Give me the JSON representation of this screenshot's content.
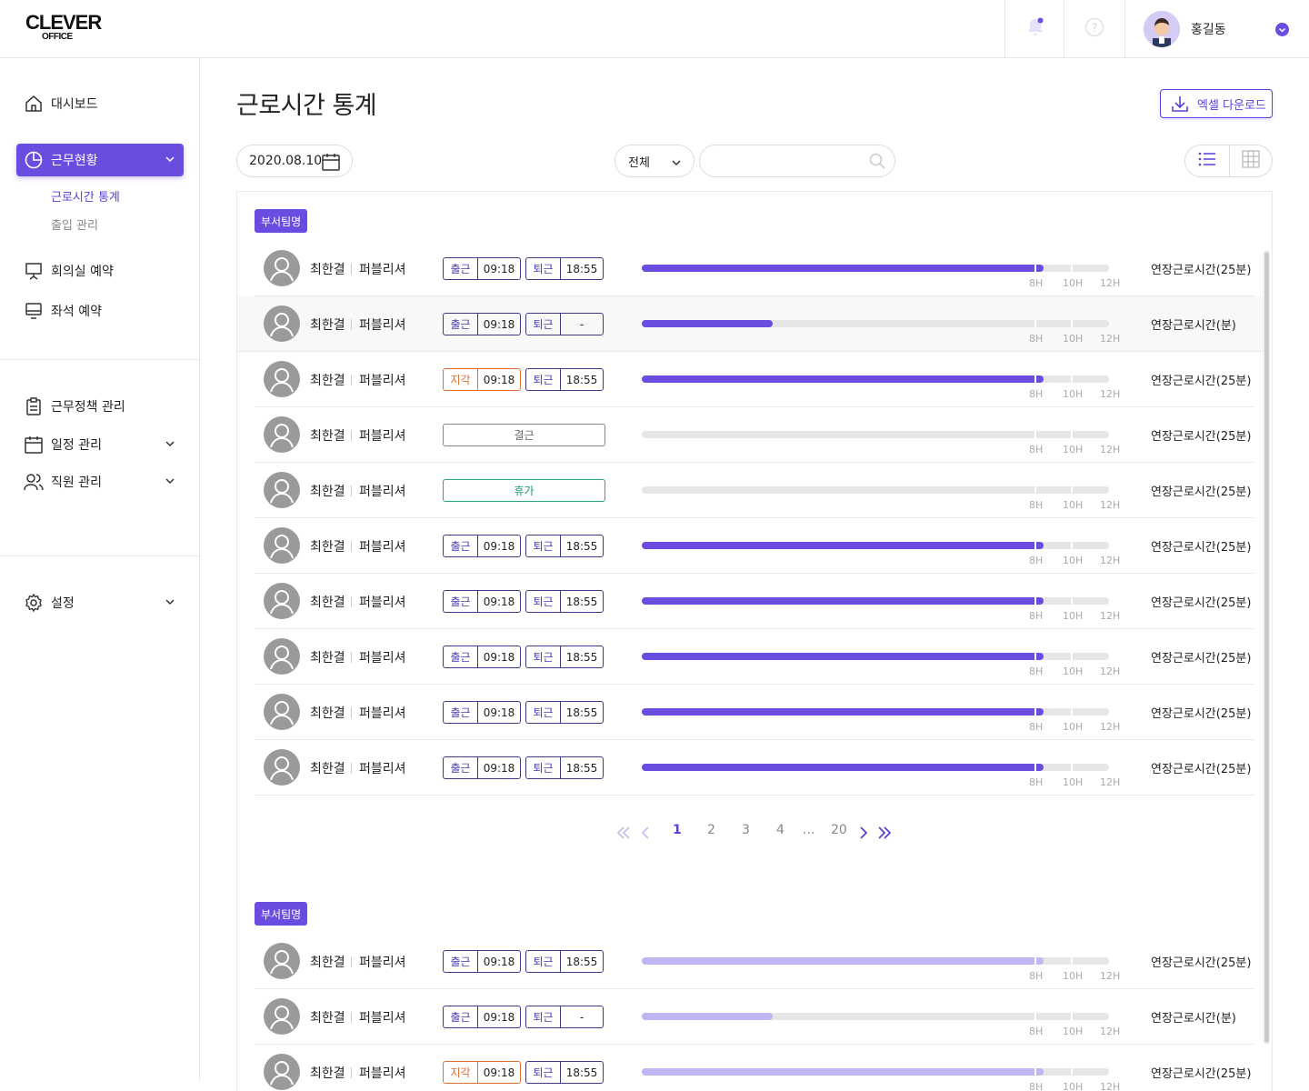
{
  "header": {
    "logo_line1": "CLEVER",
    "logo_line2": "OFFICE",
    "user_name": "홍길동",
    "icons": {
      "notifications": "bell-icon",
      "help": "help-icon",
      "dropdown": "chevron-down-circle-icon"
    }
  },
  "sidebar": {
    "dashboard": "대시보드",
    "work_status": "근무현황",
    "sub_items": [
      "근로시간 통계",
      "출입 관리"
    ],
    "meeting_room": "회의실 예약",
    "seat": "좌석 예약",
    "work_policy": "근무정책 관리",
    "schedule": "일정 관리",
    "employees": "직원 관리",
    "settings": "설정"
  },
  "main": {
    "title": "근로시간 통계",
    "excel_button": "엑셀 다운로드",
    "date": "2020.08.10",
    "filter_value": "전체",
    "search_placeholder": ""
  },
  "scale_labels": [
    "8H",
    "10H",
    "12H"
  ],
  "colors": {
    "accent": "#6a4ce0",
    "late": "#e07030",
    "vacation": "#1a9a6a"
  },
  "group1": {
    "name": "부서팀명",
    "rows": [
      {
        "name": "최한결",
        "role": "퍼블리셔",
        "type": "normal",
        "in_label": "출근",
        "in_time": "09:18",
        "out_label": "퇴근",
        "out_time": "18:55",
        "progress": 0.86,
        "overtime": "연장근로시간(25분)"
      },
      {
        "name": "최한결",
        "role": "퍼블리셔",
        "type": "normal",
        "in_label": "출근",
        "in_time": "09:18",
        "out_label": "퇴근",
        "out_time": "-",
        "progress": 0.28,
        "overtime": "연장근로시간(분)"
      },
      {
        "name": "최한결",
        "role": "퍼블리셔",
        "type": "late",
        "in_label": "지각",
        "in_time": "09:18",
        "out_label": "퇴근",
        "out_time": "18:55",
        "progress": 0.86,
        "overtime": "연장근로시간(25분)"
      },
      {
        "name": "최한결",
        "role": "퍼블리셔",
        "type": "absent",
        "status": "결근",
        "progress": 0,
        "overtime": "연장근로시간(25분)"
      },
      {
        "name": "최한결",
        "role": "퍼블리셔",
        "type": "vacation",
        "status": "휴가",
        "progress": 0,
        "overtime": "연장근로시간(25분)"
      },
      {
        "name": "최한결",
        "role": "퍼블리셔",
        "type": "normal",
        "in_label": "출근",
        "in_time": "09:18",
        "out_label": "퇴근",
        "out_time": "18:55",
        "progress": 0.86,
        "overtime": "연장근로시간(25분)"
      },
      {
        "name": "최한결",
        "role": "퍼블리셔",
        "type": "normal",
        "in_label": "출근",
        "in_time": "09:18",
        "out_label": "퇴근",
        "out_time": "18:55",
        "progress": 0.86,
        "overtime": "연장근로시간(25분)"
      },
      {
        "name": "최한결",
        "role": "퍼블리셔",
        "type": "normal",
        "in_label": "출근",
        "in_time": "09:18",
        "out_label": "퇴근",
        "out_time": "18:55",
        "progress": 0.86,
        "overtime": "연장근로시간(25분)"
      },
      {
        "name": "최한결",
        "role": "퍼블리셔",
        "type": "normal",
        "in_label": "출근",
        "in_time": "09:18",
        "out_label": "퇴근",
        "out_time": "18:55",
        "progress": 0.86,
        "overtime": "연장근로시간(25분)"
      },
      {
        "name": "최한결",
        "role": "퍼블리셔",
        "type": "normal",
        "in_label": "출근",
        "in_time": "09:18",
        "out_label": "퇴근",
        "out_time": "18:55",
        "progress": 0.86,
        "overtime": "연장근로시간(25분)"
      }
    ]
  },
  "pagination": {
    "pages": [
      "1",
      "2",
      "3",
      "4",
      "...",
      "20"
    ],
    "current": "1"
  },
  "group2": {
    "name": "부서팀명",
    "rows": [
      {
        "name": "최한결",
        "role": "퍼블리셔",
        "type": "normal",
        "in_label": "출근",
        "in_time": "09:18",
        "out_label": "퇴근",
        "out_time": "18:55",
        "progress": 0.86,
        "overtime": "연장근로시간(25분)"
      },
      {
        "name": "최한결",
        "role": "퍼블리셔",
        "type": "normal",
        "in_label": "출근",
        "in_time": "09:18",
        "out_label": "퇴근",
        "out_time": "-",
        "progress": 0.28,
        "overtime": "연장근로시간(분)"
      },
      {
        "name": "최한결",
        "role": "퍼블리셔",
        "type": "late",
        "in_label": "지각",
        "in_time": "09:18",
        "out_label": "퇴근",
        "out_time": "18:55",
        "progress": 0.86,
        "overtime": "연장근로시간(25분)"
      }
    ]
  }
}
